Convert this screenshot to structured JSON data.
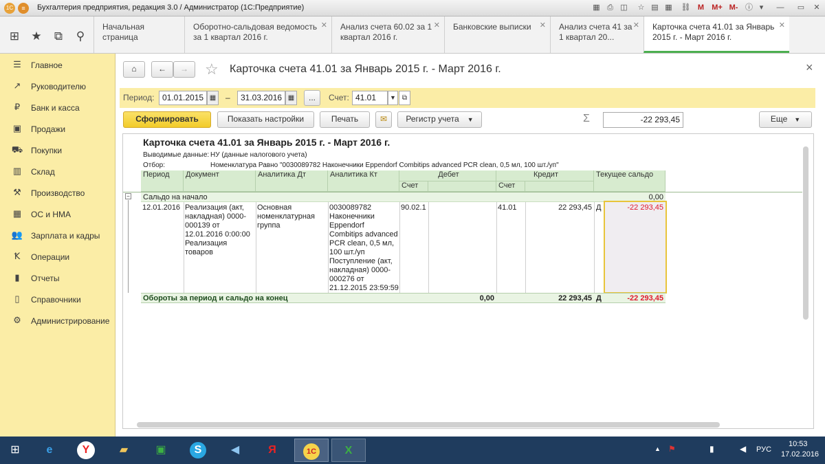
{
  "window": {
    "title": "Бухгалтерия предприятия, редакция 3.0 / Администратор  (1С:Предприятие)"
  },
  "quick_bar": {
    "apps_icon": "grid-icon",
    "favorites_icon": "star-icon",
    "history_icon": "history-icon",
    "search_icon": "search-icon"
  },
  "tabs": [
    {
      "label": "Начальная страница"
    },
    {
      "label": "Оборотно-сальдовая ведомость за 1 квартал 2016 г."
    },
    {
      "label": "Анализ счета 60.02 за 1 квартал 2016 г."
    },
    {
      "label": "Банковские выписки"
    },
    {
      "label": "Анализ счета 41 за 1 квартал 20..."
    },
    {
      "label": "Карточка счета 41.01 за Январь 2015 г. - Март 2016 г.",
      "active": true
    }
  ],
  "sidebar": {
    "items": [
      {
        "label": "Главное"
      },
      {
        "label": "Руководителю"
      },
      {
        "label": "Банк и касса"
      },
      {
        "label": "Продажи"
      },
      {
        "label": "Покупки"
      },
      {
        "label": "Склад"
      },
      {
        "label": "Производство"
      },
      {
        "label": "ОС и НМА"
      },
      {
        "label": "Зарплата и кадры"
      },
      {
        "label": "Операции"
      },
      {
        "label": "Отчеты"
      },
      {
        "label": "Справочники"
      },
      {
        "label": "Администрирование"
      }
    ]
  },
  "page": {
    "title": "Карточка счета 41.01 за Январь 2015 г. - Март 2016 г.",
    "close": "×"
  },
  "filters": {
    "period_label": "Период:",
    "date_from": "01.01.2015",
    "dash": "–",
    "date_to": "31.03.2016",
    "ellipsis": "...",
    "account_label": "Счет:",
    "account": "41.01"
  },
  "toolbar": {
    "generate": "Сформировать",
    "show_settings": "Показать настройки",
    "print": "Печать",
    "register": "Регистр учета",
    "sigma": "Σ",
    "sum": "-22 293,45",
    "more": "Еще"
  },
  "report": {
    "title": "Карточка счета 41.01 за Январь 2015 г. - Март 2016 г.",
    "output_label": "Выводимые данные:",
    "output_value": "НУ (данные налогового учета)",
    "filter_label": "Отбор:",
    "filter_value": "Номенклатура Равно \"0030089782 Наконечники Eppendorf Combitips advanced PCR clean, 0,5 мл, 100 шт./уп\"",
    "headers": {
      "period": "Период",
      "document": "Документ",
      "an_dt": "Аналитика Дт",
      "an_kt": "Аналитика Кт",
      "debit": "Дебет",
      "credit": "Кредит",
      "balance": "Текущее сальдо",
      "account": "Счет"
    },
    "opening": {
      "label": "Сальдо на начало",
      "value": "0,00"
    },
    "row": {
      "date": "12.01.2016",
      "document": "Реализация (акт, накладная) 0000-000139 от 12.01.2016 0:00:00 Реализация товаров",
      "an_dt": "Основная номенклатурная группа",
      "an_kt": "0030089782 Наконечники Eppendorf Combitips advanced PCR clean, 0,5 мл, 100 шт./уп Поступление (акт, накладная) 0000-000276 от 21.12.2015 23:59:59",
      "dt_account": "90.02.1",
      "kt_account": "41.01",
      "kt_sum": "22 293,45",
      "bal_side": "Д",
      "balance": "-22 293,45"
    },
    "totals": {
      "label": "Обороты за период и сальдо на конец",
      "debit": "0,00",
      "credit": "22 293,45",
      "bal_side": "Д",
      "balance": "-22 293,45"
    }
  },
  "taskbar": {
    "time": "10:53",
    "date": "17.02.2016",
    "lang": "РУС"
  },
  "colors": {
    "accent_yellow": "#fbeda6",
    "generate_button": "#f7d43a",
    "header_green": "#d7ebcf",
    "negative": "#e0182d"
  }
}
